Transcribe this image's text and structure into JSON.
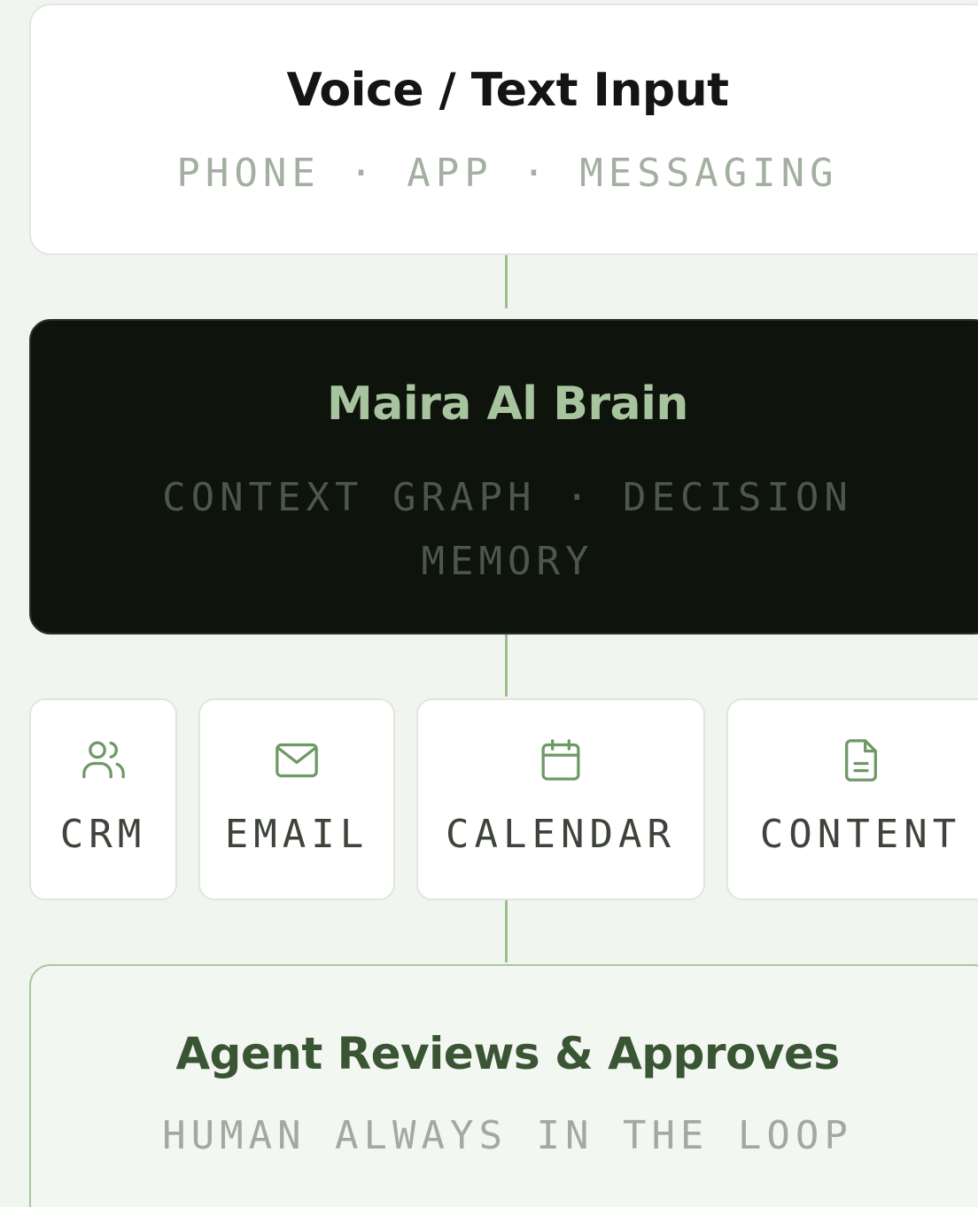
{
  "input": {
    "title": "Voice / Text Input",
    "subtitle": "PHONE · APP · MESSAGING"
  },
  "brain": {
    "title": "Maira Al Brain",
    "subtitle": "CONTEXT GRAPH · DECISION MEMORY"
  },
  "tools": [
    {
      "label": "CRM",
      "icon": "users-icon"
    },
    {
      "label": "EMAIL",
      "icon": "mail-icon"
    },
    {
      "label": "CALENDAR",
      "icon": "calendar-icon"
    },
    {
      "label": "CONTENT",
      "icon": "document-icon"
    }
  ],
  "review": {
    "title": "Agent Reviews & Approves",
    "subtitle": "HUMAN ALWAYS IN THE LOOP"
  },
  "colors": {
    "background": "#f1f5ef",
    "accent": "#9bbf8f",
    "brain_bg": "#0e130b",
    "brain_title": "#a8c49f",
    "review_title": "#3a5534",
    "icon_stroke": "#6e9966"
  }
}
